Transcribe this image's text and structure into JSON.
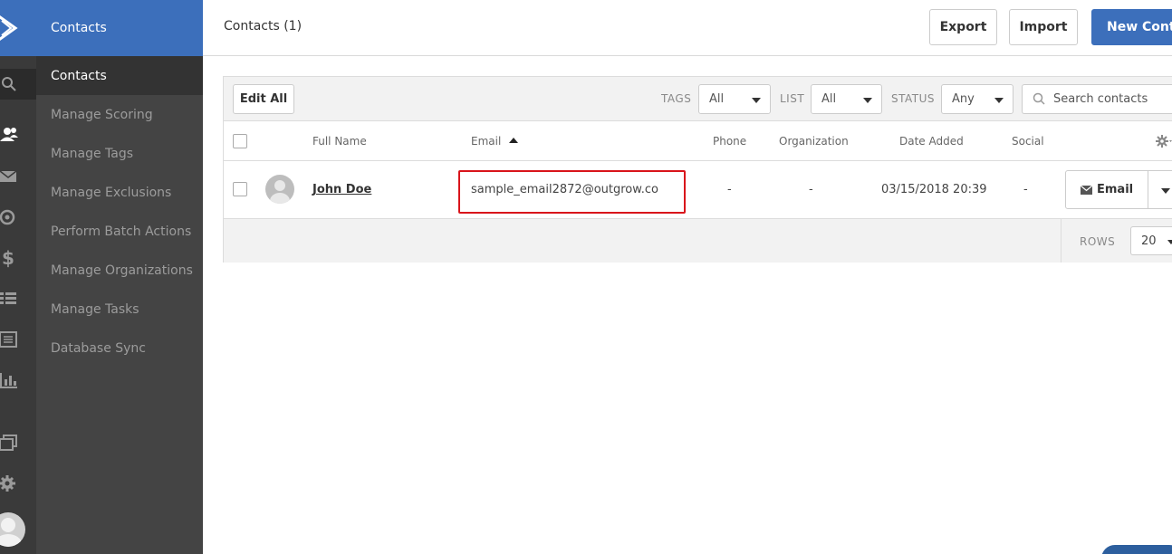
{
  "sidebar": {
    "header": "Contacts",
    "items": [
      {
        "label": "Contacts",
        "active": true
      },
      {
        "label": "Manage Scoring"
      },
      {
        "label": "Manage Tags"
      },
      {
        "label": "Manage Exclusions"
      },
      {
        "label": "Perform Batch Actions"
      },
      {
        "label": "Manage Organizations"
      },
      {
        "label": "Manage Tasks"
      },
      {
        "label": "Database Sync"
      }
    ]
  },
  "rail_icons": [
    "logo-icon",
    "search-icon",
    "contacts-icon",
    "mail-icon",
    "automation-icon",
    "dollar-icon",
    "list-icon",
    "forms-icon",
    "reports-icon",
    "windows-icon",
    "gear-icon",
    "avatar"
  ],
  "header": {
    "title": "Contacts (1)",
    "export_label": "Export",
    "import_label": "Import",
    "new_contact_label": "New Contact"
  },
  "toolbar": {
    "edit_all_label": "Edit All",
    "tags_label": "TAGS",
    "tags_value": "All",
    "list_label": "LIST",
    "list_value": "All",
    "status_label": "STATUS",
    "status_value": "Any",
    "search_placeholder": "Search contacts"
  },
  "table": {
    "columns": [
      "Full Name",
      "Email",
      "Phone",
      "Organization",
      "Date Added",
      "Social"
    ],
    "rows": [
      {
        "full_name": "John Doe",
        "email": "sample_email2872@outgrow.co",
        "phone": "-",
        "organization": "-",
        "date_added": "03/15/2018 20:39",
        "social": "-",
        "action_label": "Email"
      }
    ]
  },
  "footer": {
    "rows_label": "ROWS",
    "rows_value": "20"
  },
  "colors": {
    "brand_blue": "#3c6fbb",
    "highlight_red": "#d9141b",
    "sidebar_dark": "#444444",
    "rail_dark": "#3a3a3a"
  }
}
